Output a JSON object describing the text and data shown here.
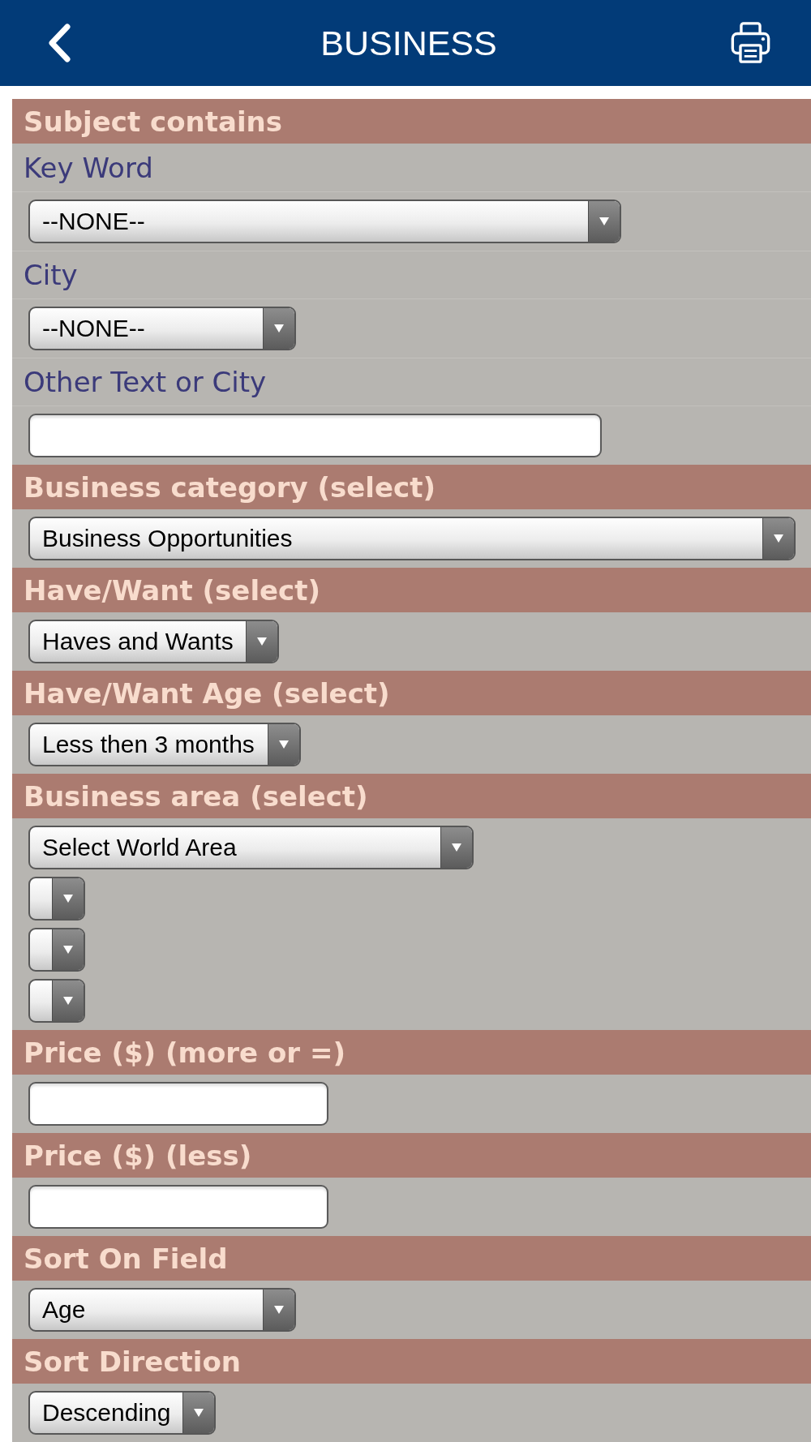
{
  "top_bar": {
    "title": "BUSINESS"
  },
  "sections": [
    {
      "title": "Subject contains",
      "items": [
        {
          "kind": "label",
          "text": "Key Word"
        },
        {
          "kind": "select",
          "value": "--NONE--"
        },
        {
          "kind": "label",
          "text": "City"
        },
        {
          "kind": "select",
          "value": "--NONE--"
        },
        {
          "kind": "label",
          "text": "Other Text or City"
        },
        {
          "kind": "input"
        }
      ]
    },
    {
      "title": "Business category (select)",
      "items": [
        {
          "kind": "select",
          "value": "Business Opportunities"
        }
      ]
    },
    {
      "title": "Have/Want (select)",
      "items": [
        {
          "kind": "select",
          "value": "Haves and Wants"
        }
      ]
    },
    {
      "title": "Have/Want Age (select)",
      "items": [
        {
          "kind": "select",
          "value": "Less then 3 months"
        }
      ]
    },
    {
      "title": "Business area (select)",
      "items": [
        {
          "kind": "select",
          "value": "Select World Area"
        },
        {
          "kind": "select"
        },
        {
          "kind": "select"
        },
        {
          "kind": "select"
        }
      ]
    },
    {
      "title": "Price ($) (more or =)",
      "items": [
        {
          "kind": "input"
        }
      ]
    },
    {
      "title": "Price ($) (less)",
      "items": [
        {
          "kind": "input"
        }
      ]
    },
    {
      "title": "Sort On Field",
      "items": [
        {
          "kind": "select",
          "value": "Age"
        }
      ]
    },
    {
      "title": "Sort Direction",
      "items": [
        {
          "kind": "select",
          "value": "Descending"
        }
      ]
    }
  ]
}
